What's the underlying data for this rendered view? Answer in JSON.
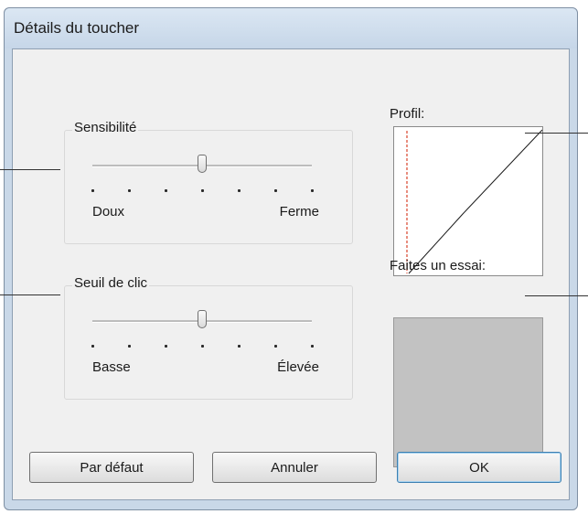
{
  "window": {
    "title": "Détails du toucher"
  },
  "sensitivity": {
    "label": "Sensibilité",
    "min_label": "Doux",
    "max_label": "Ferme",
    "tick_count": 7,
    "value_fraction": 0.5
  },
  "click_threshold": {
    "label": "Seuil de clic",
    "min_label": "Basse",
    "max_label": "Élevée",
    "tick_count": 7,
    "value_fraction": 0.5
  },
  "profile": {
    "label": "Profil:"
  },
  "test_area": {
    "label": "Faites un essai:"
  },
  "buttons": {
    "default_label": "Par défaut",
    "cancel_label": "Annuler",
    "ok_label": "OK"
  },
  "colors": {
    "title_bar": "#c9d8e8",
    "client": "#f0f0f0",
    "test_area": "#c2c2c2",
    "profile_marker": "#d9432b",
    "ok_focus": "#3c7fb1"
  }
}
